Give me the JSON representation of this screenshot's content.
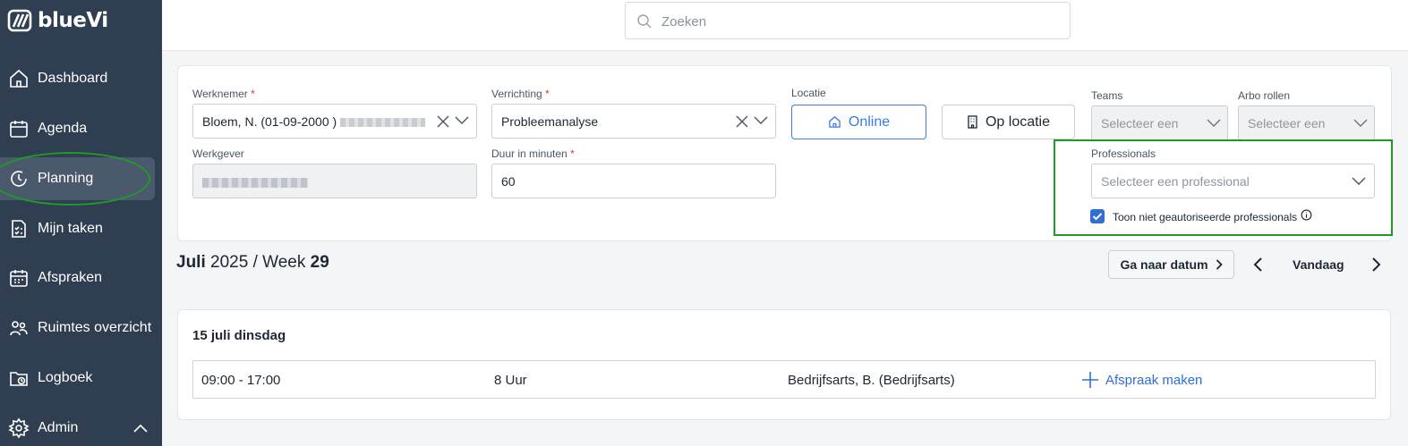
{
  "app": {
    "brand": "blueVi"
  },
  "sidebar": {
    "items": [
      {
        "label": "Dashboard",
        "icon": "home-icon"
      },
      {
        "label": "Agenda",
        "icon": "calendar-icon"
      },
      {
        "label": "Planning",
        "icon": "clock-icon",
        "active": true
      },
      {
        "label": "Mijn taken",
        "icon": "checklist-icon"
      },
      {
        "label": "Afspraken",
        "icon": "calendar-grid-icon"
      },
      {
        "label": "Ruimtes overzicht",
        "icon": "people-icon"
      },
      {
        "label": "Logboek",
        "icon": "folder-clock-icon"
      },
      {
        "label": "Admin",
        "icon": "gear-icon"
      }
    ]
  },
  "search": {
    "placeholder": "Zoeken"
  },
  "form": {
    "werknemer": {
      "label": "Werknemer",
      "value": "Bloem, N. (01-09-2000 )"
    },
    "verrichting": {
      "label": "Verrichting",
      "value": "Probleemanalyse"
    },
    "locatie": {
      "label": "Locatie",
      "online": "Online",
      "op_locatie": "Op locatie"
    },
    "teams": {
      "label": "Teams",
      "placeholder": "Selecteer een"
    },
    "arbo": {
      "label": "Arbo rollen",
      "placeholder": "Selecteer een"
    },
    "werkgever": {
      "label": "Werkgever"
    },
    "duur": {
      "label": "Duur in minuten",
      "value": "60"
    },
    "professionals": {
      "label": "Professionals",
      "placeholder": "Selecteer een professional"
    },
    "toon_niet": {
      "label": "Toon niet geautoriseerde professionals",
      "checked": true
    },
    "required_mark": "*"
  },
  "week": {
    "month": "Juli",
    "year": "2025",
    "sep": "/",
    "week_label": "Week",
    "week_no": "29",
    "goto_label": "Ga naar datum",
    "today_label": "Vandaag"
  },
  "day": {
    "title": "15 juli dinsdag",
    "row": {
      "time": "09:00 - 17:00",
      "hours": "8 Uur",
      "professional": "Bedrijfsarts, B. (Bedrijfsarts)",
      "action": "Afspraak maken"
    }
  }
}
